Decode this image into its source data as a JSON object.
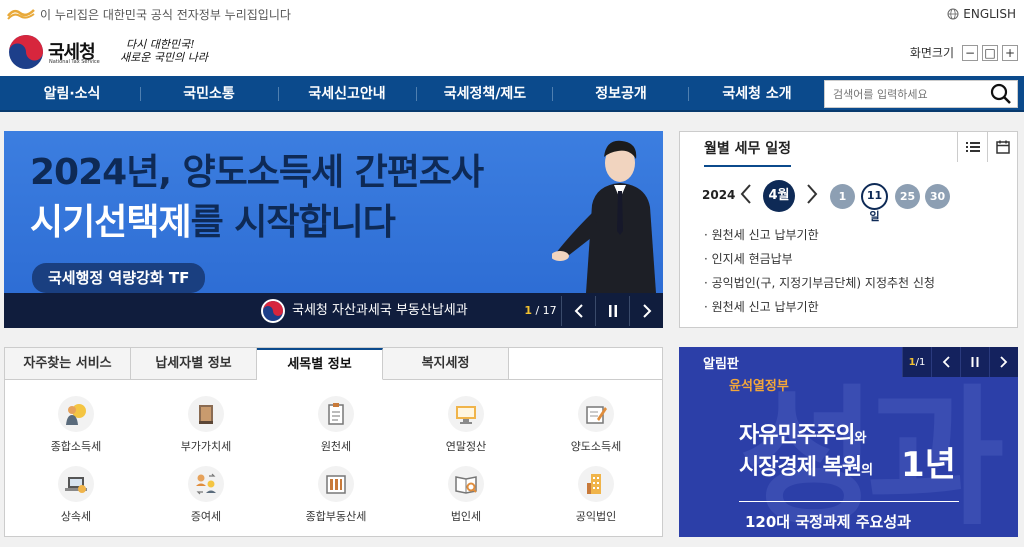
{
  "topbar": {
    "gov_notice": "이 누리집은 대한민국 공식 전자정부 누리집입니다",
    "language": "ENGLISH"
  },
  "header": {
    "logo_name": "국세청",
    "logo_sub": "National Tax Service",
    "slogan_line1": "다시 대한민국!",
    "slogan_line2": "새로운 국민의 나라",
    "zoom_label": "화면크기",
    "zoom_minus": "−",
    "zoom_reset": "□",
    "zoom_plus": "+"
  },
  "nav": {
    "items": [
      "알림·소식",
      "국민소통",
      "국세신고안내",
      "국세정책/제도",
      "정보공개",
      "국세청 소개"
    ],
    "search_placeholder": "검색어를 입력하세요"
  },
  "banner": {
    "line1": "2024년, 양도소득세 간편조사",
    "line2_white": "시기선택제",
    "line2_dark": "를 시작합니다",
    "tag": "국세행정 역량강화 TF",
    "org": "국세청 자산과세국 부동산납세과",
    "counter_current": "1",
    "counter_total": "/ 17"
  },
  "schedule": {
    "title": "월별 세무 일정",
    "year": "2024",
    "month": "4월",
    "days": [
      "1",
      "11일",
      "25",
      "30"
    ],
    "active_day_index": 1,
    "items": [
      "· 원천세 신고 납부기한",
      "· 인지세 현금납부",
      "· 공익법인(구, 지정기부금단체) 지정추천 신청",
      "· 원천세 신고 납부기한"
    ]
  },
  "service": {
    "tabs": [
      "자주찾는 서비스",
      "납세자별 정보",
      "세목별 정보",
      "복지세정"
    ],
    "active_tab_index": 2,
    "items": [
      {
        "label": "종합소득세",
        "icon": "person-bulb-icon"
      },
      {
        "label": "부가가치세",
        "icon": "book-icon"
      },
      {
        "label": "원천세",
        "icon": "clipboard-icon"
      },
      {
        "label": "연말정산",
        "icon": "monitor-icon"
      },
      {
        "label": "양도소득세",
        "icon": "document-pen-icon"
      },
      {
        "label": "상속세",
        "icon": "laptop-icon"
      },
      {
        "label": "증여세",
        "icon": "people-exchange-icon"
      },
      {
        "label": "종합부동산세",
        "icon": "building-icon"
      },
      {
        "label": "법인세",
        "icon": "book-search-icon"
      },
      {
        "label": "공익법인",
        "icon": "tower-icon"
      }
    ]
  },
  "board": {
    "title": "알림판",
    "counter_current": "1",
    "counter_total": "/1",
    "gov": "윤석열정부",
    "line1": "자유민주주의",
    "line1_suffix": "와",
    "line2": "시장경제 복원",
    "line2_suffix": "의",
    "big": "1년",
    "bottom": "120대 국정과제 주요성과"
  },
  "colors": {
    "nav_blue": "#0b4a8c",
    "banner_blue": "#2b6ad2",
    "dark_navy": "#0e2a56",
    "board_blue": "#2c3fa8",
    "accent_orange": "#f2a63a"
  }
}
